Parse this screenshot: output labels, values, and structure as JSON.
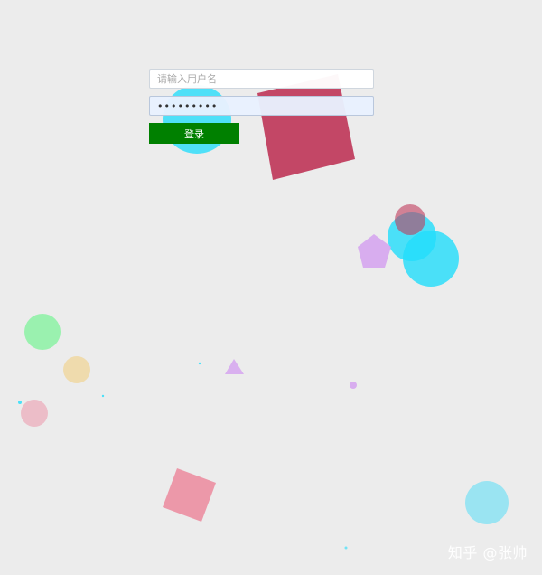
{
  "login": {
    "username_placeholder": "请输入用户名",
    "username_value": "",
    "password_value": "123456789",
    "submit_label": "登录"
  },
  "watermark": {
    "text": "知乎 @张帅"
  },
  "colors": {
    "background": "#ececec",
    "button": "#008000",
    "crimson": "#c03a5b",
    "cyan": "#22ddfb",
    "violet": "#d6a6f0",
    "green": "#91f2a9",
    "sand": "#f0d9a6",
    "pink": "#ecb8c4",
    "rose": "#ec93a5",
    "sky": "#96e4f2"
  }
}
